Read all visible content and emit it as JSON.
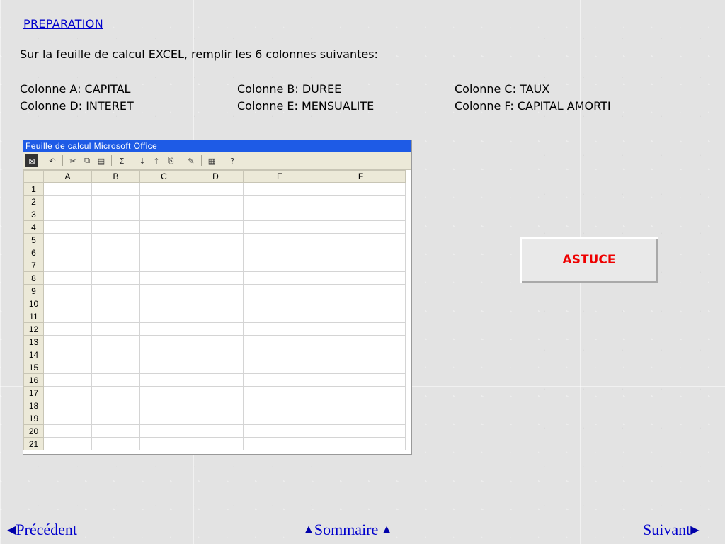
{
  "header": {
    "title": "PREPARATION"
  },
  "instructions": {
    "intro": "Sur la feuille de calcul EXCEL, remplir les 6 colonnes suivantes:",
    "columns": [
      "Colonne A: CAPITAL",
      "Colonne B: DUREE",
      "Colonne C: TAUX",
      "Colonne D: INTERET",
      "Colonne E: MENSUALITE",
      "Colonne F: CAPITAL AMORTI"
    ]
  },
  "spreadsheet": {
    "title": "Feuille de calcul Microsoft Office",
    "column_headers": [
      "A",
      "B",
      "C",
      "D",
      "E",
      "F"
    ],
    "row_numbers": [
      "1",
      "2",
      "3",
      "4",
      "5",
      "6",
      "7",
      "8",
      "9",
      "10",
      "11",
      "12",
      "13",
      "14",
      "15",
      "16",
      "17",
      "18",
      "19",
      "20",
      "21"
    ],
    "toolbar_icons": [
      "office-logo-icon",
      "undo-icon",
      "cut-icon",
      "copy-icon",
      "paste-icon",
      "autosum-icon",
      "sort-ascending-icon",
      "sort-descending-icon",
      "export-icon",
      "format-icon",
      "properties-icon",
      "help-icon"
    ]
  },
  "hint_button": {
    "label": "ASTUCE"
  },
  "navigation": {
    "previous": "Précédent",
    "summary": "Sommaire",
    "next": "Suivant"
  }
}
